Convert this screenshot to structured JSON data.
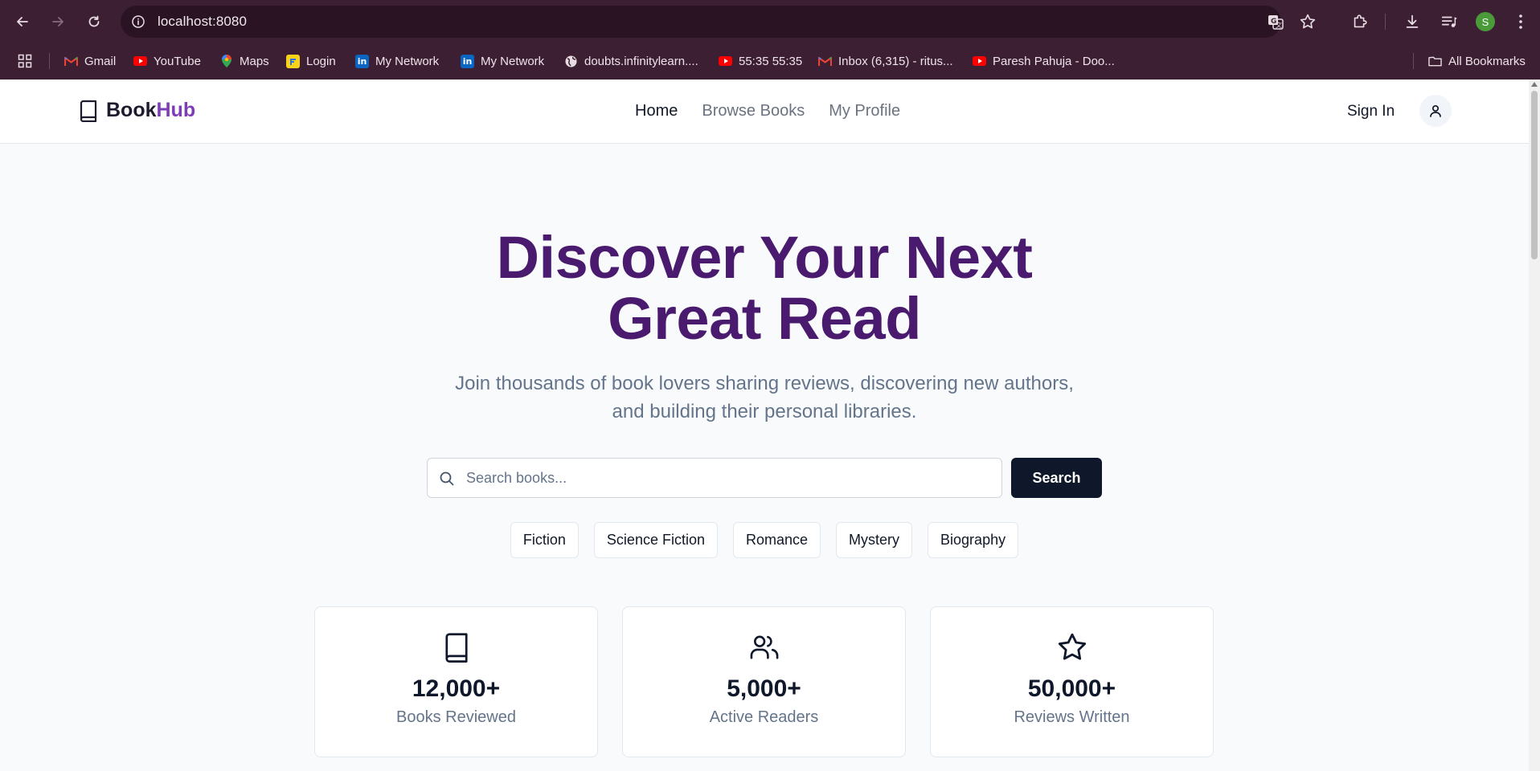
{
  "browser": {
    "url": "localhost:8080",
    "profile_initial": "S",
    "bookmarks": [
      {
        "label": "Gmail",
        "icon": "gmail-icon"
      },
      {
        "label": "YouTube",
        "icon": "youtube-icon"
      },
      {
        "label": "Maps",
        "icon": "maps-icon"
      },
      {
        "label": "Login",
        "icon": "flipkart-icon"
      },
      {
        "label": "My Network",
        "icon": "linkedin-icon"
      },
      {
        "label": "My Network",
        "icon": "linkedin-icon"
      },
      {
        "label": "doubts.infinitylearn....",
        "icon": "globe-icon"
      },
      {
        "label": "55:35 55:35",
        "icon": "youtube-icon"
      },
      {
        "label": "Inbox (6,315) - ritus...",
        "icon": "gmail-icon"
      },
      {
        "label": "Paresh Pahuja - Doo...",
        "icon": "youtube-icon"
      }
    ],
    "all_bookmarks_label": "All Bookmarks"
  },
  "nav": {
    "logo_book": "Book",
    "logo_hub": "Hub",
    "links": [
      "Home",
      "Browse Books",
      "My Profile"
    ],
    "sign_in": "Sign In"
  },
  "hero": {
    "title_line1": "Discover Your Next",
    "title_line2": "Great Read",
    "subtitle_line1": "Join thousands of book lovers sharing reviews, discovering new authors,",
    "subtitle_line2": "and building their personal libraries."
  },
  "search": {
    "placeholder": "Search books...",
    "button_label": "Search"
  },
  "genres": [
    "Fiction",
    "Science Fiction",
    "Romance",
    "Mystery",
    "Biography"
  ],
  "stats": [
    {
      "icon": "book-icon",
      "value": "12,000+",
      "label": "Books Reviewed"
    },
    {
      "icon": "users-icon",
      "value": "5,000+",
      "label": "Active Readers"
    },
    {
      "icon": "star-icon",
      "value": "50,000+",
      "label": "Reviews Written"
    }
  ],
  "colors": {
    "chrome_bg": "#3c1f33",
    "title_purple": "#4a1a6e",
    "logo_accent": "#7e3db5",
    "search_button": "#0f172a"
  }
}
